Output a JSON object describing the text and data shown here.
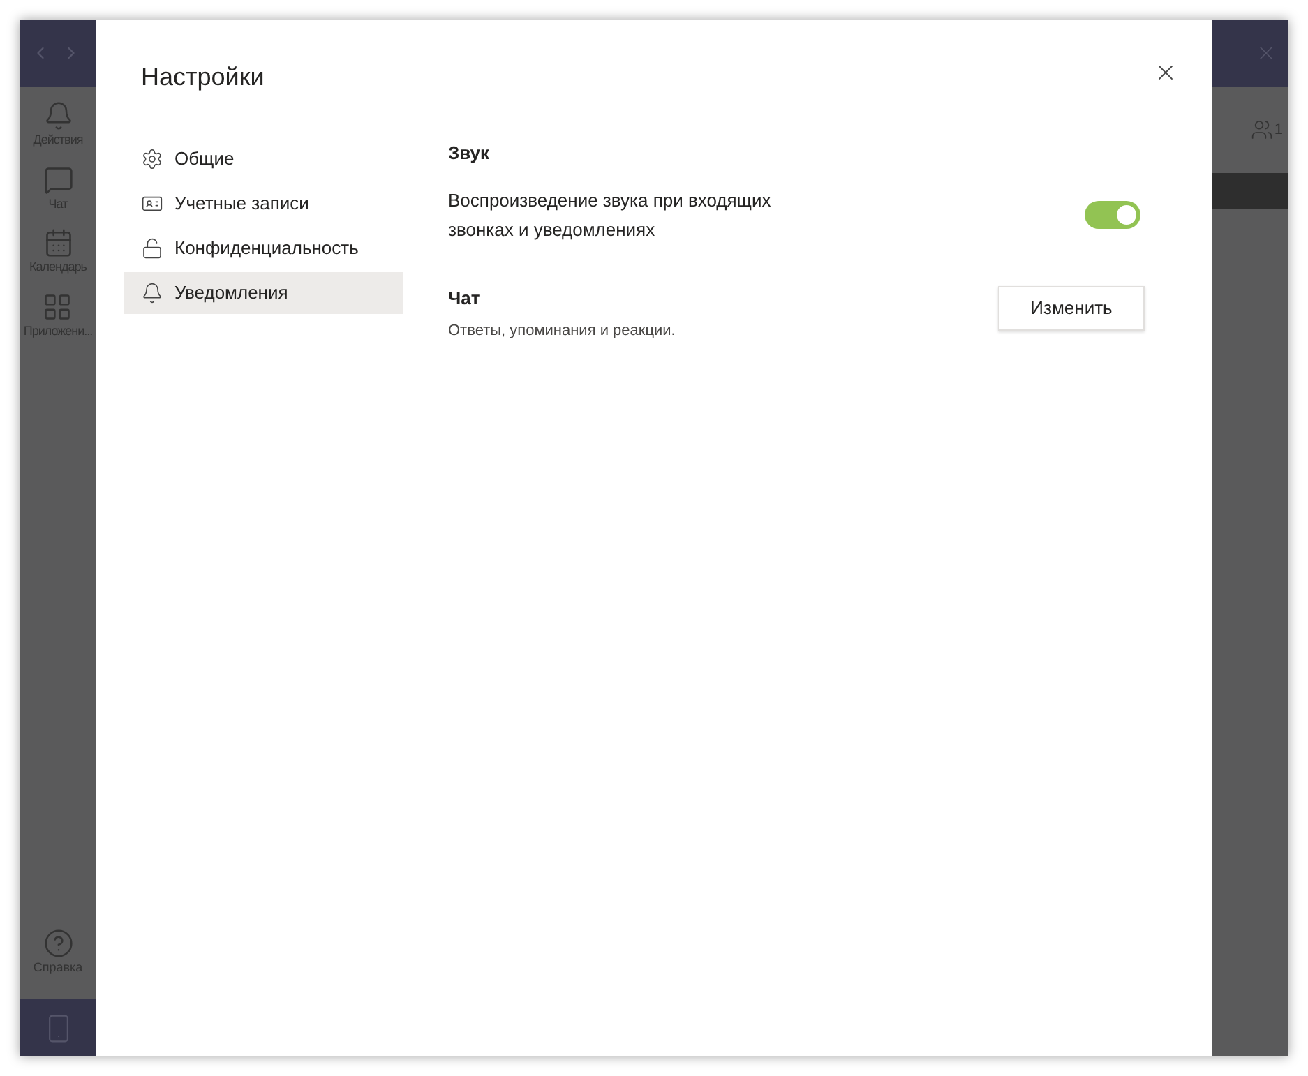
{
  "app_rail": {
    "items": [
      {
        "label": "Действия"
      },
      {
        "label": "Чат"
      },
      {
        "label": "Календарь"
      },
      {
        "label": "Приложени..."
      }
    ],
    "help": {
      "label": "Справка"
    }
  },
  "header_badge": "1",
  "dialog": {
    "title": "Настройки",
    "nav": [
      {
        "label": "Общие",
        "selected": false
      },
      {
        "label": "Учетные записи",
        "selected": false
      },
      {
        "label": "Конфиденциальность",
        "selected": false
      },
      {
        "label": "Уведомления",
        "selected": true
      }
    ],
    "sections": [
      {
        "kind": "toggle",
        "heading": "Звук",
        "label": "Воспроизведение звука при входящих звонках и уведомлениях",
        "on": true
      },
      {
        "kind": "button",
        "heading": "Чат",
        "description": "Ответы, упоминания и реакции.",
        "button": "Изменить"
      }
    ]
  }
}
